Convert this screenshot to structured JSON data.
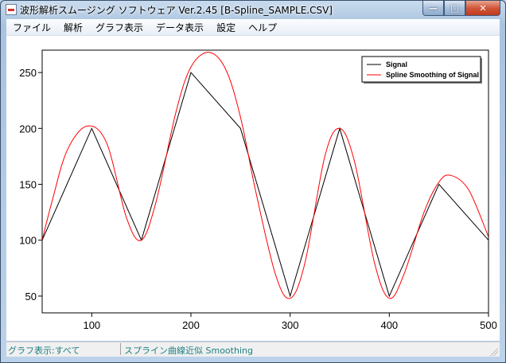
{
  "window": {
    "title": "波形解析スムージング ソフトウェア Ver.2.45  [B-Spline_SAMPLE.CSV]",
    "buttons": {
      "minimize": "—",
      "maximize": "□",
      "close": "✕"
    }
  },
  "menu": [
    "ファイル",
    "解析",
    "グラフ表示",
    "データ表示",
    "設定",
    "ヘルプ"
  ],
  "status": {
    "left": "グラフ表示:すべて",
    "right": "スプライン曲線近似 Smoothing"
  },
  "colors": {
    "signal": "#000000",
    "smooth": "#ff0000"
  },
  "chart_data": {
    "type": "line",
    "title": "",
    "xlabel": "",
    "ylabel": "",
    "xlim": [
      50,
      500
    ],
    "ylim": [
      35,
      270
    ],
    "xticks": [
      100,
      200,
      300,
      400,
      500
    ],
    "yticks": [
      50,
      100,
      150,
      200,
      250
    ],
    "grid": false,
    "legend_position": "top-right",
    "series": [
      {
        "name": "Signal",
        "color": "#000000",
        "x": [
          50,
          100,
          150,
          200,
          250,
          300,
          350,
          400,
          450,
          500
        ],
        "y": [
          100,
          200,
          100,
          250,
          200,
          50,
          200,
          50,
          150,
          100
        ]
      },
      {
        "name": "Spline Smoothing of Signal",
        "color": "#ff0000",
        "x": [
          50,
          60,
          75,
          95,
          115,
          135,
          150,
          165,
          185,
          200,
          218,
          235,
          250,
          265,
          285,
          300,
          315,
          335,
          350,
          365,
          385,
          400,
          415,
          435,
          450,
          462,
          480,
          500
        ],
        "y": [
          100,
          135,
          180,
          202,
          187,
          120,
          100,
          135,
          215,
          255,
          268,
          253,
          210,
          145,
          70,
          48,
          80,
          175,
          200,
          170,
          80,
          48,
          70,
          125,
          152,
          158,
          145,
          103
        ]
      }
    ]
  }
}
